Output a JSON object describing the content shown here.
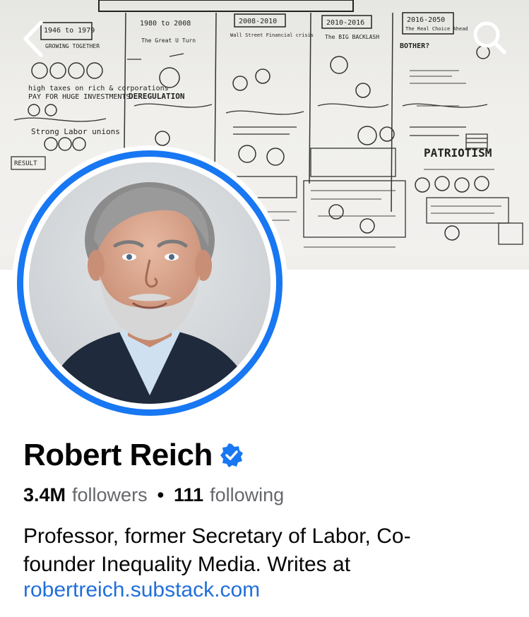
{
  "profile": {
    "name": "Robert Reich",
    "followers_count": "3.4M",
    "followers_label": "followers",
    "separator": "•",
    "following_count": "111",
    "following_label": "following",
    "bio_line1": "Professor, former Secretary of Labor, Co-",
    "bio_line2": "founder Inequality Media. Writes at",
    "link": "robertreich.substack.com"
  },
  "cover_sketch": {
    "years": [
      "1946 to 1979",
      "1980 to 2008",
      "2008-2010",
      "2010-2016",
      "2016-2050"
    ],
    "subtitles": [
      "GROWING TOGETHER",
      "The Great U Turn",
      "Wall Street Financial crisis",
      "The BIG BACKLASH",
      "The Real Choice Ahead"
    ],
    "notes": [
      "high taxes on rich & corporations",
      "PAY FOR HUGE INVESTMENTS",
      "DEREGULATION",
      "Strong Labor unions",
      "RESULT",
      "PATRIOTISM",
      "BOTHER?"
    ]
  },
  "icons": {
    "back": "chevron-left-icon",
    "search": "search-icon",
    "verified": "verified-badge-icon"
  },
  "colors": {
    "accent": "#1877f2",
    "link": "#216fdb",
    "secondary_text": "#65676b"
  }
}
